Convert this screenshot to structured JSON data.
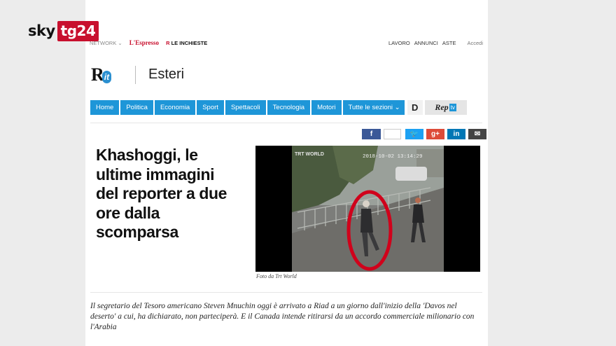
{
  "logo": {
    "sky": "sky",
    "tg24": "tg24"
  },
  "topbar": {
    "network": "NETWORK ⌄",
    "espresso": "L'Espresso",
    "inchieste_mark": "R",
    "inchieste": "LE INCHIESTE",
    "links": [
      "LAVORO",
      "ANNUNCI",
      "ASTE"
    ],
    "login": "Accedi"
  },
  "header": {
    "brand_r": "R",
    "brand_it": "it",
    "section": "Esteri"
  },
  "nav": {
    "items": [
      "Home",
      "Politica",
      "Economia",
      "Sport",
      "Spettacoli",
      "Tecnologia",
      "Motori",
      "Tutte le sezioni ⌄"
    ],
    "d_label": "D",
    "rep": "Rep",
    "tv": "tv"
  },
  "social": {
    "facebook": "f",
    "twitter": "🐦",
    "gplus": "g+",
    "linkedin": "in",
    "email": "✉"
  },
  "article": {
    "headline_lines": [
      "Khashoggi, le",
      "ultime immagini",
      "del reporter a due",
      "ore dalla",
      "scomparsa"
    ],
    "photo": {
      "watermark": "TRT WORLD",
      "timestamp": "2018-10-02 13:14:29"
    },
    "caption": "Foto da Trt World",
    "lead": "Il segretario del Tesoro americano Steven Mnuchin oggi è arrivato a Riad a un giorno dall'inizio della 'Davos nel deserto' a cui, ha dichiarato, non parteciperà. E il Canada intende ritirarsi da un accordo commerciale milionario con l'Arabia"
  },
  "colors": {
    "nav_blue": "#1e96d8",
    "sky_red": "#c8102e",
    "highlight_circle": "#d0021b"
  }
}
